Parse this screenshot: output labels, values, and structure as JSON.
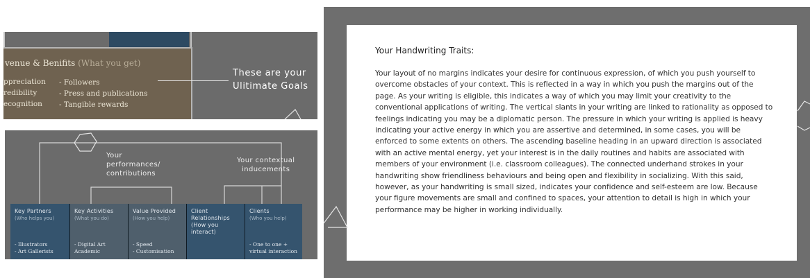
{
  "top_slide": {
    "section_title": "venue & Benifits",
    "section_subtitle": "(What you get)",
    "col1": [
      "ppreciation",
      "redibility",
      "ecognition"
    ],
    "col2": [
      "- Followers",
      "- Press and publications",
      "- Tangible rewards"
    ],
    "goal_line1": "These are your",
    "goal_line2": "Ulitimate Goals"
  },
  "bottom_slide": {
    "label_performances": [
      "Your",
      "performances/",
      "contributions"
    ],
    "label_contextual": [
      "Your contextual",
      "inducements"
    ],
    "columns": [
      {
        "head": "Key Partners",
        "sub": "(Who helps you)",
        "items": [
          "- Illustrators",
          "- Art Gallerists"
        ],
        "tone": "blue"
      },
      {
        "head": "Key Activities",
        "sub": "(What you do)",
        "items": [
          "- Digital Art",
          "  Academic"
        ],
        "tone": "grey"
      },
      {
        "head": "Value Provided",
        "sub": "(How you help)",
        "items": [
          "- Speed",
          "- Customisation"
        ],
        "tone": "grey"
      },
      {
        "head": "Client Relationships (How you interact)",
        "sub": "",
        "items": [],
        "tone": "blue"
      },
      {
        "head": "Clients",
        "sub": "(Who you help)",
        "items": [
          "- One to one +",
          "virtual interaction"
        ],
        "tone": "blue"
      }
    ]
  },
  "right_card": {
    "title": "Your Handwriting Traits:",
    "body": "Your layout of no margins indicates your desire for continuous expression, of which you push yourself to overcome obstacles of your context. This is reflected in a way in which you push the margins out of the page. As your writing is eligible, this indicates a way of which you may limit your creativity to the conventional applications of writing. The vertical slants in your writing are linked to rationality as opposed to feelings indicating you may be a diplomatic person. The pressure in which your writing is applied is heavy indicating your active energy in which you are assertive and determined, in some cases, you will be enforced to some extents on others. The ascending baseline heading in an upward direction is associated with an active mental energy, yet your interest is in the daily routines and habits are associated with members of your environment (i.e. classroom colleagues). The connected underhand strokes in your handwriting show friendliness behaviours and being open and flexibility in socializing. With this said, however, as your handwriting is small sized, indicates your confidence and self-esteem are low. Because your figure movements are small and confined to spaces, your attention to detail is high in which your performance may be higher in working individually."
  },
  "colors": {
    "panel_grey": "#6b6b6b",
    "brown_box": "#6f6250",
    "navy": "#2e4a62"
  }
}
